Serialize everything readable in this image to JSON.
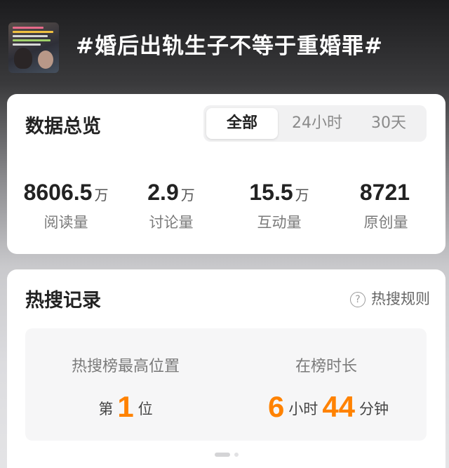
{
  "header": {
    "title": "#婚后出轨生子不等于重婚罪#"
  },
  "overview": {
    "title": "数据总览",
    "tabs": [
      {
        "label": "全部",
        "active": true
      },
      {
        "label": "24小时",
        "active": false
      },
      {
        "label": "30天",
        "active": false
      }
    ],
    "stats": [
      {
        "value": "8606.5",
        "unit": "万",
        "label": "阅读量"
      },
      {
        "value": "2.9",
        "unit": "万",
        "label": "讨论量"
      },
      {
        "value": "15.5",
        "unit": "万",
        "label": "互动量"
      },
      {
        "value": "8721",
        "unit": "",
        "label": "原创量"
      }
    ]
  },
  "hot_search": {
    "title": "热搜记录",
    "rules_label": "热搜规则",
    "rules_icon": "question-circle-icon",
    "peak_caption": "热搜榜最高位置",
    "peak_prefix": "第",
    "peak_value": "1",
    "peak_suffix": "位",
    "duration_caption": "在榜时长",
    "duration_hours": "6",
    "duration_hours_unit": "小时",
    "duration_minutes": "44",
    "duration_minutes_unit": "分钟",
    "accent_color": "#ff8200"
  }
}
